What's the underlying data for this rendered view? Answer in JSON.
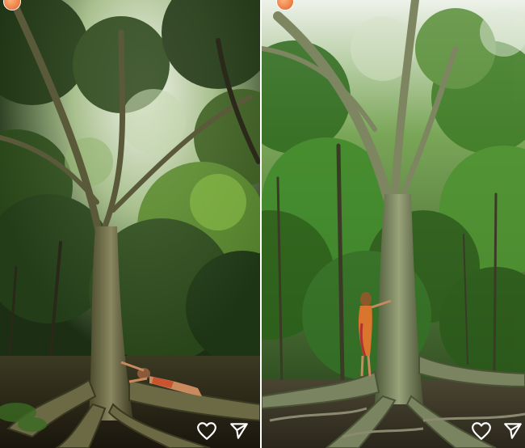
{
  "panels": [
    {
      "scene": "forest-photo",
      "palette": {
        "sky": "#e9efe6",
        "canopy": "#2f4a1f",
        "canopy_light": "#6f9a3a",
        "trunk": "#6b6a45",
        "ground": "#2a2418",
        "person_outfit": "#c9542f"
      },
      "actions": {
        "like_icon": "heart-icon",
        "share_icon": "send-icon"
      }
    },
    {
      "scene": "forest-photo",
      "palette": {
        "sky": "#e6ece4",
        "canopy": "#2b4f1c",
        "canopy_light": "#5d9a35",
        "trunk": "#7d8661",
        "ground": "#3a3326",
        "person_outfit": "#d9752c"
      },
      "actions": {
        "like_icon": "heart-icon",
        "share_icon": "send-icon"
      }
    }
  ],
  "icon_color": "#ffffff"
}
